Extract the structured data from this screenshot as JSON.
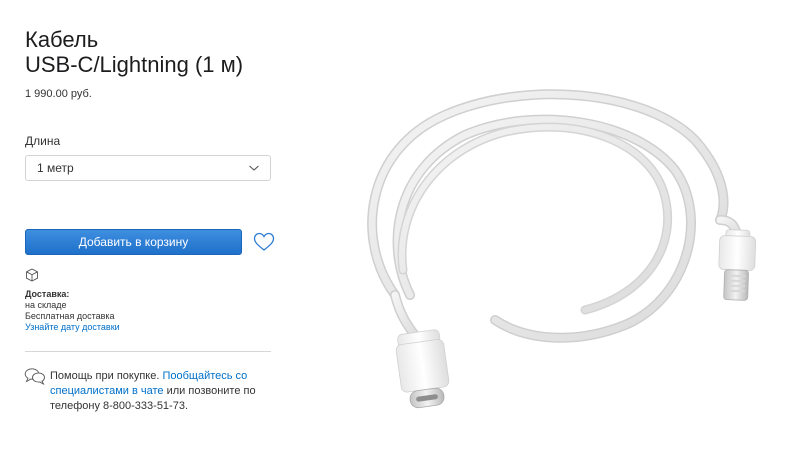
{
  "product": {
    "title_line1": "Кабель",
    "title_line2": "USB-C/Lightning (1 м)",
    "price": "1 990.00 руб."
  },
  "options": {
    "length_label": "Длина",
    "length_selected": "1 метр"
  },
  "actions": {
    "add_to_cart": "Добавить в корзину"
  },
  "delivery": {
    "heading": "Доставка:",
    "stock": "на складе",
    "shipping": "Бесплатная доставка",
    "date_link": "Узнайте дату доставки"
  },
  "help": {
    "intro": "Помощь при покупке. ",
    "chat_link": "Пообщайтесь со специалистами в чате",
    "rest": " или позвоните по телефону 8-800-333-51-73."
  },
  "colors": {
    "accent": "#0070c9",
    "button": "#2a7bd4"
  },
  "icons": [
    "chevron-down-icon",
    "heart-icon",
    "box-icon",
    "chat-bubbles-icon"
  ]
}
